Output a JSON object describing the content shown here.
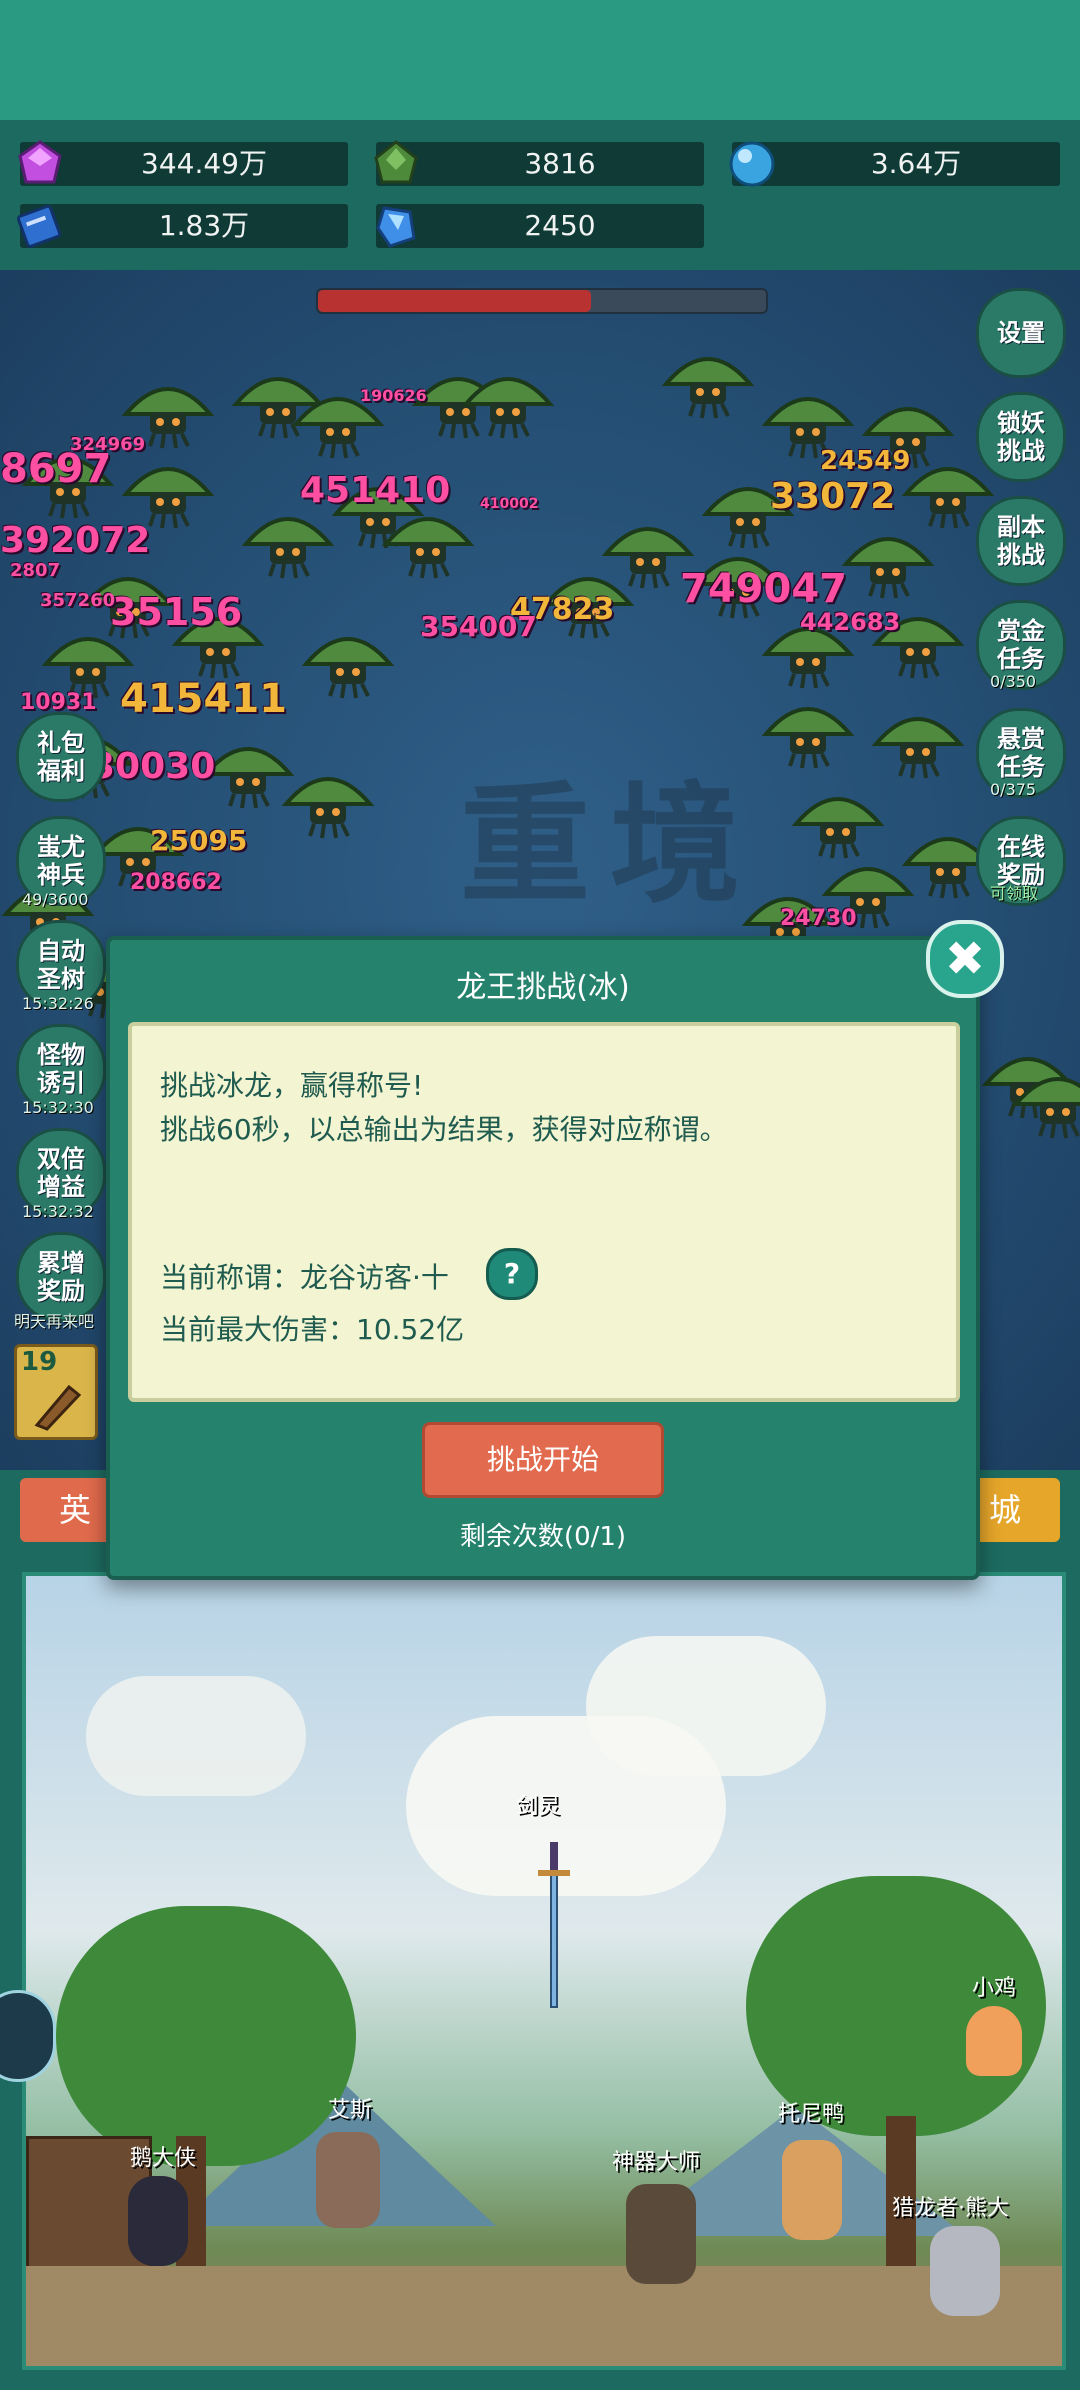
{
  "resources": [
    {
      "icon": "gem-icon",
      "value": "344.49万"
    },
    {
      "icon": "green-crystal-icon",
      "value": "3816"
    },
    {
      "icon": "blue-orb-icon",
      "value": "3.64万"
    },
    {
      "icon": "blue-book-icon",
      "value": "1.83万"
    },
    {
      "icon": "blue-shard-icon",
      "value": "2450"
    }
  ],
  "boss_hp_fraction": 0.61,
  "watermark": "重境",
  "right_menu": [
    {
      "label": "设置",
      "note": ""
    },
    {
      "label": "锁妖挑战",
      "note": ""
    },
    {
      "label": "副本挑战",
      "note": ""
    },
    {
      "label": "赏金任务",
      "note": "0/350"
    },
    {
      "label": "悬赏任务",
      "note": "0/375"
    },
    {
      "label": "在线奖励",
      "note": "可领取"
    }
  ],
  "left_menu": [
    {
      "label": "礼包福利",
      "note": ""
    },
    {
      "label": "蚩尤神兵",
      "note": "49/3600"
    },
    {
      "label": "自动圣树",
      "note": "15:32:26"
    },
    {
      "label": "怪物诱引",
      "note": "15:32:30"
    },
    {
      "label": "双倍增益",
      "note": "15:32:32"
    },
    {
      "label": "累增奖励",
      "note": "明天再来吧"
    }
  ],
  "damage_numbers": [
    "8697",
    "392072",
    "451410",
    "35156",
    "415411",
    "30030",
    "25095",
    "47823",
    "354007",
    "749047",
    "442683",
    "24549",
    "33072",
    "208662",
    "24730",
    "10931",
    "324969",
    "357260",
    "190626",
    "410002",
    "2807"
  ],
  "skill_slot_level": "19",
  "tabs": {
    "left": "英",
    "right": "城"
  },
  "modal": {
    "title": "龙王挑战(冰)",
    "line1": "挑战冰龙，赢得称号!",
    "line2": "挑战60秒，以总输出为结果，获得对应称谓。",
    "title_label": "当前称谓：龙谷访客·十",
    "damage_label": "当前最大伤害：10.52亿",
    "help_icon": "?",
    "start_button": "挑战开始",
    "remaining": "剩余次数(0/1)",
    "close_icon": "✖"
  },
  "npcs": [
    "剑灵",
    "小鸡",
    "艾斯",
    "托尼鸭",
    "鹅大侠",
    "神器大师",
    "猎龙者·熊大"
  ]
}
